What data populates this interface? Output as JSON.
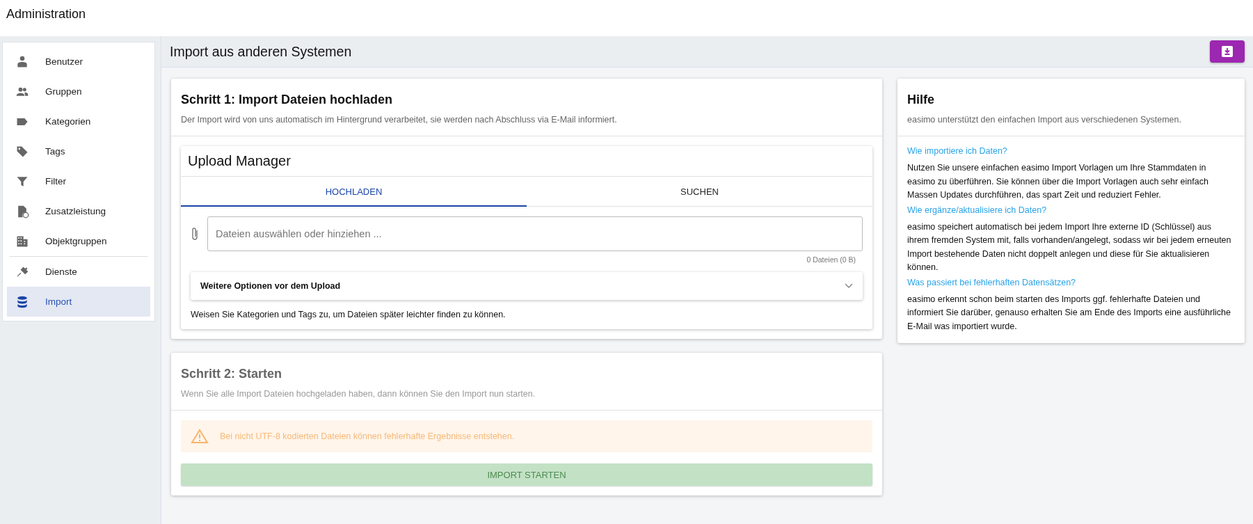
{
  "app_title": "Administration",
  "sidebar": {
    "groups": [
      [
        {
          "label": "Benutzer",
          "selected": false
        },
        {
          "label": "Gruppen",
          "selected": false
        },
        {
          "label": "Kategorien",
          "selected": false
        },
        {
          "label": "Tags",
          "selected": false
        },
        {
          "label": "Filter",
          "selected": false
        },
        {
          "label": "Zusatzleistung",
          "selected": false
        },
        {
          "label": "Objektgruppen",
          "selected": false
        }
      ],
      [
        {
          "label": "Dienste",
          "selected": false
        },
        {
          "label": "Import",
          "selected": true
        }
      ]
    ]
  },
  "page_title": "Import aus anderen Systemen",
  "step1": {
    "title": "Schritt 1: Import Dateien hochladen",
    "subtitle": "Der Import wird von uns automatisch im Hintergrund verarbeitet, sie werden nach Abschluss via E-Mail informiert.",
    "upload_manager": {
      "title": "Upload Manager",
      "tabs": [
        {
          "label": "HOCHLADEN",
          "selected": true
        },
        {
          "label": "SUCHEN",
          "selected": false
        }
      ],
      "file_field": {
        "placeholder": "Dateien auswählen oder hinziehen ..."
      },
      "file_count": "0 Dateien (0 B)",
      "options_panel": {
        "title": "Weitere Optionen vor dem Upload",
        "expanded": false
      },
      "hint": "Weisen Sie Kategorien und Tags zu, um Dateien später leichter finden zu können."
    }
  },
  "step2": {
    "title": "Schritt 2: Starten",
    "subtitle": "Wenn Sie alle Import Dateien hochgeladen haben, dann können Sie den Import nun starten.",
    "disabled": true,
    "warning": "Bei nicht UTF-8 kodierten Dateien können fehlerhafte Ergebnisse entstehen.",
    "button": "IMPORT STARTEN"
  },
  "help": {
    "title": "Hilfe",
    "subtitle": "easimo unterstützt den einfachen Import aus verschiedenen Systemen.",
    "sections": [
      {
        "question": "Wie importiere ich Daten?",
        "answer": "Nutzen Sie unsere einfachen easimo Import Vorlagen um Ihre Stammdaten in easimo zu überführen. Sie können über die Import Vorlagen auch sehr einfach Massen Updates durchführen, das spart Zeit und reduziert Fehler."
      },
      {
        "question": "Wie ergänze/aktualisiere ich Daten?",
        "answer": "easimo speichert automatisch bei jedem Import Ihre externe ID (Schlüssel) aus ihrem fremden System mit, falls vorhanden/angelegt, sodass wir bei jedem erneuten Import bestehende Daten nicht doppelt anlegen und diese für Sie aktualisieren können."
      },
      {
        "question": "Was passiert bei fehlerhaften Datensätzen?",
        "answer": "easimo erkennt schon beim starten des Imports ggf. fehlerhafte Dateien und informiert Sie darüber, genauso erhalten Sie am Ende des Imports eine ausführliche E-Mail was importiert wurde."
      }
    ]
  }
}
